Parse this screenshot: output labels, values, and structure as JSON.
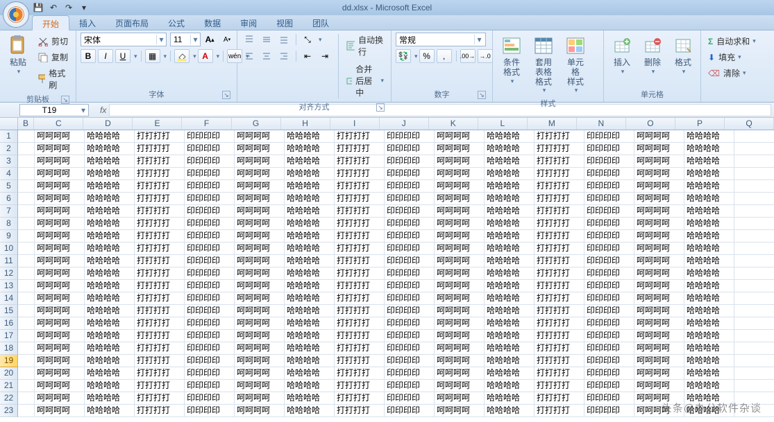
{
  "title": "dd.xlsx - Microsoft Excel",
  "qat": {
    "save": "💾",
    "undo": "↶",
    "redo": "↷"
  },
  "tabs": [
    "开始",
    "插入",
    "页面布局",
    "公式",
    "数据",
    "审阅",
    "视图",
    "团队"
  ],
  "active_tab": 0,
  "clipboard": {
    "paste": "粘贴",
    "cut": "剪切",
    "copy": "复制",
    "format_painter": "格式刷",
    "label": "剪贴板"
  },
  "font": {
    "name": "宋体",
    "size": "11",
    "bold": "B",
    "italic": "I",
    "underline": "U",
    "border": "▦",
    "fill_dd": "▾",
    "color_dd": "▾",
    "grow": "A",
    "shrink": "A",
    "label": "字体",
    "pinyin": "wén"
  },
  "align": {
    "wrap": "自动换行",
    "merge": "合并后居中",
    "label": "对齐方式"
  },
  "number": {
    "general": "常规",
    "percent": "%",
    "comma": ",",
    "inc": ".0→.00",
    "dec": ".00→.0",
    "currency": "$",
    "label": "数字"
  },
  "styles": {
    "cond": "条件格式",
    "table": "套用\n表格格式",
    "cell": "单元格\n样式",
    "label": "样式"
  },
  "cellsgrp": {
    "insert": "插入",
    "delete": "删除",
    "format": "格式",
    "label": "单元格"
  },
  "editing": {
    "sum": "自动求和",
    "fill": "填充",
    "clear": "清除"
  },
  "namebox": "T19",
  "columns": [
    "B",
    "C",
    "D",
    "E",
    "F",
    "G",
    "H",
    "I",
    "J",
    "K",
    "L",
    "M",
    "N",
    "O",
    "P",
    "Q"
  ],
  "row_start": 1,
  "row_count": 23,
  "selected_row": 19,
  "pattern": [
    "呵呵呵呵",
    "哈哈哈哈",
    "打打打打",
    "印印印印"
  ],
  "watermark": "头条@办公软件杂谈"
}
